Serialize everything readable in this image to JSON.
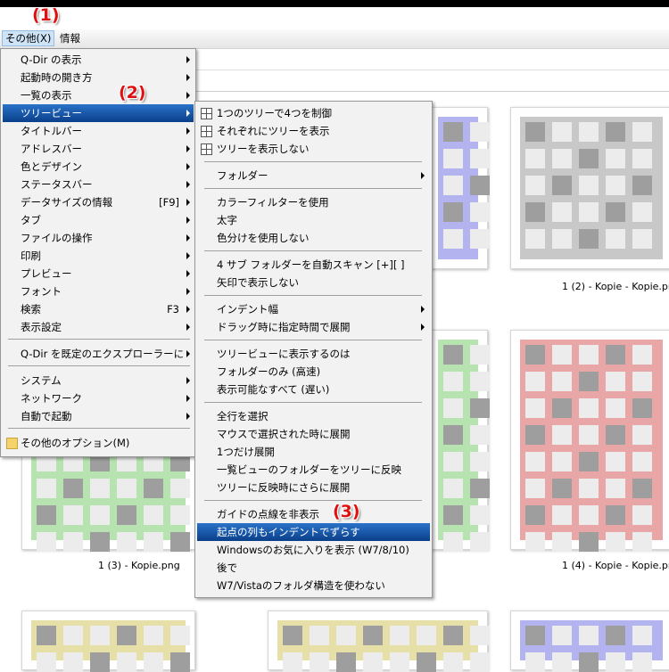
{
  "menubar": {
    "items": [
      {
        "label": "その他(X)"
      },
      {
        "label": "情報"
      }
    ]
  },
  "callouts": [
    "(1)",
    "(2)",
    "(3)"
  ],
  "thumbnails": [
    {
      "caption": "1 (2) - Kopie - Kopie.png",
      "color": "#c8c8c8"
    },
    {
      "caption": "1 (3) - Kopie.png",
      "color": "#b7e3b0"
    },
    {
      "caption": "1 (4) - Kopie - Kopie.png",
      "color": "#e9a6a6"
    }
  ],
  "menu1": {
    "items": [
      {
        "label": "Q-Dir の表示",
        "shortcut": "",
        "submenu": true
      },
      {
        "label": "起動時の開き方",
        "shortcut": "",
        "submenu": true
      },
      {
        "label": "一覧の表示",
        "shortcut": "",
        "submenu": true
      },
      {
        "label": "ツリービュー",
        "shortcut": "",
        "submenu": true
      },
      {
        "label": "タイトルバー",
        "shortcut": "",
        "submenu": true
      },
      {
        "label": "アドレスバー",
        "shortcut": "",
        "submenu": true
      },
      {
        "label": "色とデザイン",
        "shortcut": "",
        "submenu": true
      },
      {
        "label": "ステータスバー",
        "shortcut": "",
        "submenu": true
      },
      {
        "label": "データサイズの情報",
        "shortcut": "[F9]",
        "submenu": true
      },
      {
        "label": "タブ",
        "shortcut": "",
        "submenu": true
      },
      {
        "label": "ファイルの操作",
        "shortcut": "",
        "submenu": true
      },
      {
        "label": "印刷",
        "shortcut": "",
        "submenu": true
      },
      {
        "label": "プレビュー",
        "shortcut": "",
        "submenu": true
      },
      {
        "label": "フォント",
        "shortcut": "",
        "submenu": true
      },
      {
        "label": "検索",
        "shortcut": "F3",
        "submenu": true
      },
      {
        "label": "表示設定",
        "shortcut": "",
        "submenu": true
      },
      {
        "label": "Q-Dir を既定のエクスプローラーに",
        "shortcut": "",
        "submenu": true
      },
      {
        "label": "システム",
        "shortcut": "",
        "submenu": true
      },
      {
        "label": "ネットワーク",
        "shortcut": "",
        "submenu": true
      },
      {
        "label": "自動で起動",
        "shortcut": "",
        "submenu": true
      },
      {
        "label": "その他のオプション(M)",
        "shortcut": "",
        "submenu": false
      }
    ]
  },
  "menu2": {
    "items": [
      {
        "label": "1つのツリーで4つを制御",
        "submenu": false
      },
      {
        "label": "それぞれにツリーを表示",
        "submenu": false
      },
      {
        "label": "ツリーを表示しない",
        "submenu": false
      },
      {
        "label": "フォルダー",
        "submenu": true
      },
      {
        "label": "カラーフィルターを使用",
        "submenu": false
      },
      {
        "label": "太字",
        "submenu": false
      },
      {
        "label": "色分けを使用しない",
        "submenu": false
      },
      {
        "label": "4 サブ フォルダーを自動スキャン [+][ ]",
        "submenu": false
      },
      {
        "label": "矢印で表示しない",
        "submenu": false
      },
      {
        "label": "インデント幅",
        "submenu": true
      },
      {
        "label": "ドラッグ時に指定時間で展開",
        "submenu": true
      },
      {
        "label": "ツリービューに表示するのは",
        "submenu": false
      },
      {
        "label": "フォルダーのみ (高速)",
        "submenu": false
      },
      {
        "label": "表示可能なすべて (遅い)",
        "submenu": false
      },
      {
        "label": "全行を選択",
        "submenu": false
      },
      {
        "label": "マウスで選択された時に展開",
        "submenu": false
      },
      {
        "label": "1つだけ展開",
        "submenu": false
      },
      {
        "label": "一覧ビューのフォルダーをツリーに反映",
        "submenu": false
      },
      {
        "label": "ツリーに反映時にさらに展開",
        "submenu": false
      },
      {
        "label": "ガイドの点線を非表示",
        "submenu": false
      },
      {
        "label": "起点の列もインデントでずらす",
        "submenu": false
      },
      {
        "label": "Windowsのお気に入りを表示 (W7/8/10)",
        "submenu": false
      },
      {
        "label": "後で",
        "submenu": false
      },
      {
        "label": "W7/Vistaのフォルダ構造を使わない",
        "submenu": false
      }
    ]
  },
  "colors": {
    "highlight": "#1a5bb0",
    "callout": "#e01010"
  }
}
